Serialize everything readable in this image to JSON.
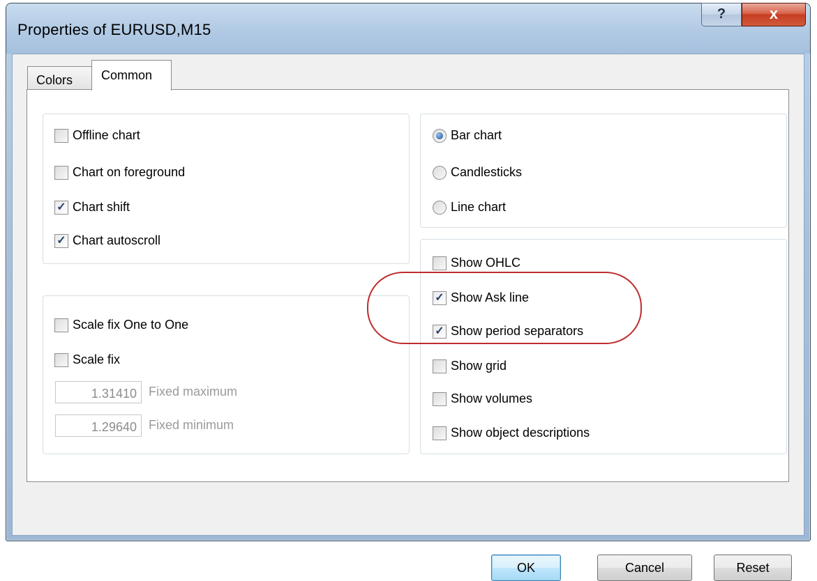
{
  "window": {
    "title": "Properties of EURUSD,M15",
    "help_label": "?",
    "close_label": "x"
  },
  "tabs": [
    {
      "label": "Colors",
      "active": false
    },
    {
      "label": "Common",
      "active": true
    }
  ],
  "chart_options": [
    {
      "label": "Offline chart",
      "checked": false
    },
    {
      "label": "Chart on foreground",
      "checked": false
    },
    {
      "label": "Chart shift",
      "checked": true
    },
    {
      "label": "Chart autoscroll",
      "checked": true
    }
  ],
  "scale": {
    "fix_one_to_one": {
      "label": "Scale fix One to One",
      "checked": false
    },
    "fix": {
      "label": "Scale fix",
      "checked": false
    },
    "fixed_maximum": {
      "value": "1.31410",
      "label": "Fixed maximum"
    },
    "fixed_minimum": {
      "value": "1.29640",
      "label": "Fixed minimum"
    }
  },
  "chart_type": [
    {
      "label": "Bar chart",
      "selected": true
    },
    {
      "label": "Candlesticks",
      "selected": false
    },
    {
      "label": "Line chart",
      "selected": false
    }
  ],
  "show_options": [
    {
      "label": "Show OHLC",
      "checked": false
    },
    {
      "label": "Show Ask line",
      "checked": true
    },
    {
      "label": "Show period separators",
      "checked": true
    },
    {
      "label": "Show grid",
      "checked": false
    },
    {
      "label": "Show volumes",
      "checked": false
    },
    {
      "label": "Show object descriptions",
      "checked": false
    }
  ],
  "buttons": {
    "ok": "OK",
    "cancel": "Cancel",
    "reset": "Reset"
  },
  "check_glyph": "✓",
  "colors": {
    "highlight_ellipse": "#bf2c2e",
    "close_button": "#c73d22"
  }
}
